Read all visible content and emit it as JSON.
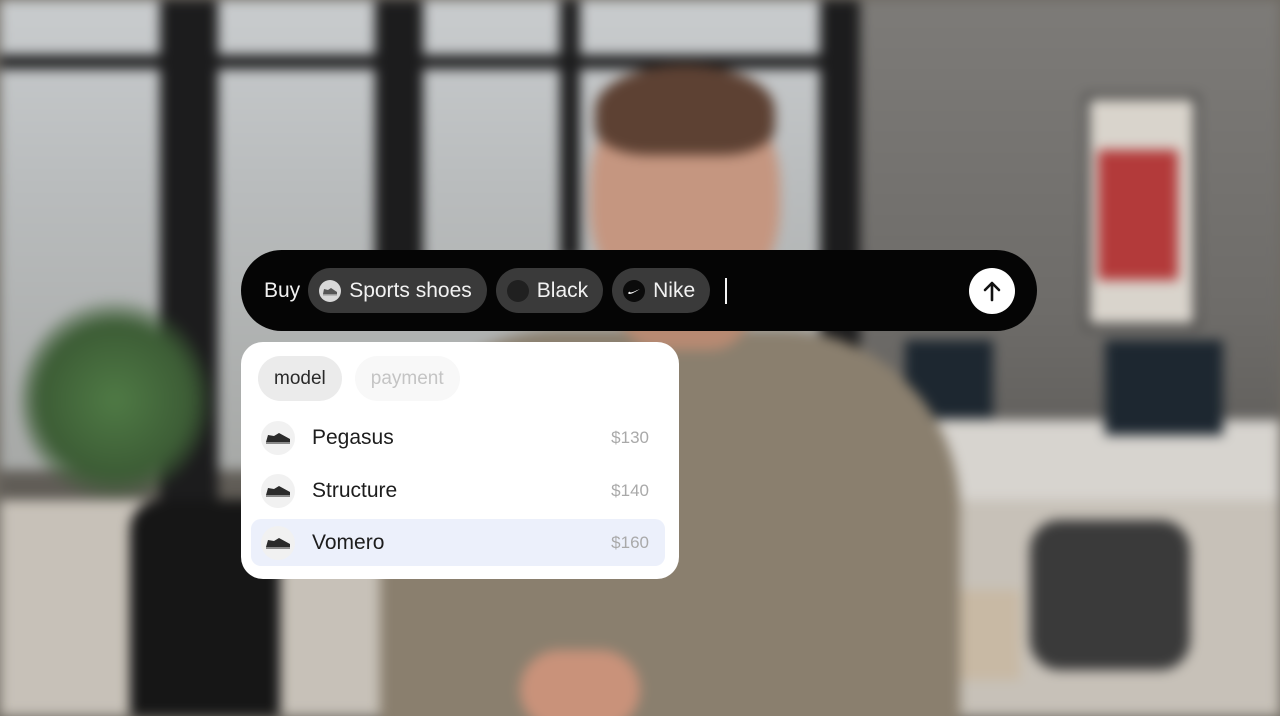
{
  "prompt": {
    "verb": "Buy",
    "chips": [
      {
        "label": "Sports shoes",
        "icon": "shoe-icon"
      },
      {
        "label": "Black",
        "icon": "color-swatch-icon"
      },
      {
        "label": "Nike",
        "icon": "nike-logo-icon"
      }
    ],
    "send_icon": "arrow-up-icon"
  },
  "suggestions": {
    "tabs": [
      {
        "label": "model",
        "active": true
      },
      {
        "label": "payment",
        "active": false
      }
    ],
    "items": [
      {
        "name": "Pegasus",
        "price": "$130",
        "selected": false
      },
      {
        "name": "Structure",
        "price": "$140",
        "selected": false
      },
      {
        "name": "Vomero",
        "price": "$160",
        "selected": true
      }
    ]
  },
  "colors": {
    "bar_background": "#050505",
    "chip_background": "#3a3a3a",
    "selected_row": "#ecf0fb"
  }
}
